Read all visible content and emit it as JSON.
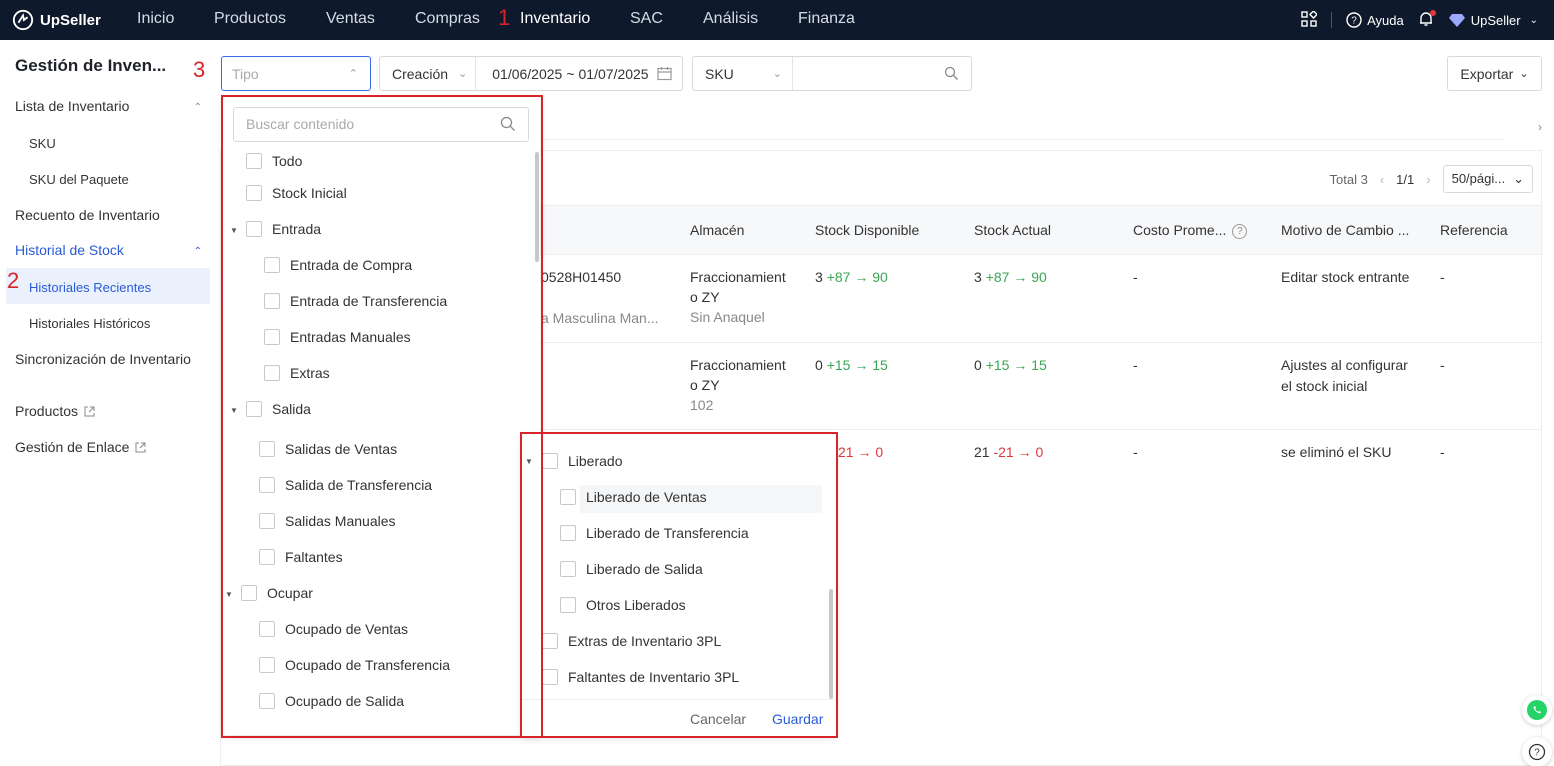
{
  "topbar": {
    "brand": "UpSeller",
    "nav": [
      "Inicio",
      "Productos",
      "Ventas",
      "Compras",
      "Inventario",
      "SAC",
      "Análisis",
      "Finanza"
    ],
    "active_nav": "Inventario",
    "help": "Ayuda",
    "user": "UpSeller"
  },
  "annotations": {
    "one": "1",
    "two": "2",
    "three": "3"
  },
  "sidebar": {
    "title": "Gestión de Inven...",
    "items": {
      "lista": "Lista de Inventario",
      "sku": "SKU",
      "sku_paquete": "SKU del Paquete",
      "recuento": "Recuento de Inventario",
      "historial": "Historial de Stock",
      "recientes": "Historiales Recientes",
      "historicos": "Historiales Históricos",
      "sincronizacion": "Sincronización de Inventario",
      "productos": "Productos",
      "enlace": "Gestión de Enlace"
    }
  },
  "filters": {
    "tipo_placeholder": "Tipo",
    "date_type": "Creación",
    "date_from": "01/06/2025",
    "date_sep": "~",
    "date_to": "01/07/2025",
    "search_field": "SKU",
    "export": "Exportar"
  },
  "pager": {
    "total": "Total 3",
    "page": "1/1",
    "page_size": "50/pági..."
  },
  "table": {
    "headers": [
      "Almacén",
      "Stock Disponible",
      "Stock Actual",
      "Costo Prome...",
      "Motivo de Cambio ...",
      "Referencia"
    ],
    "rows": [
      {
        "sku": "0528H01450",
        "product": "a Masculina Man...",
        "warehouse": "Fraccionamient",
        "warehouse2": "o ZY",
        "shelf": "Sin Anaquel",
        "disp_base": "3",
        "disp_delta": "+87 → 90",
        "act_base": "3",
        "act_delta": "+87 → 90",
        "cost": "-",
        "reason": "Editar stock entrante",
        "reason2": "",
        "ref": "-"
      },
      {
        "sku": "",
        "product": "",
        "warehouse": "Fraccionamient",
        "warehouse2": "o ZY",
        "shelf": "102",
        "disp_base": "0",
        "disp_delta": "+15 → 15",
        "act_base": "0",
        "act_delta": "+15 → 15",
        "cost": "-",
        "reason": "Ajustes al configurar",
        "reason2": "el stock inicial",
        "ref": "-"
      },
      {
        "disp_delta": "21 → 0",
        "act_base": "21",
        "act_delta": "-21 → 0",
        "cost": "-",
        "reason": "se eliminó el SKU",
        "ref": "-"
      }
    ]
  },
  "dropdown": {
    "search_placeholder": "Buscar contenido",
    "left": {
      "todo": "Todo",
      "stock_inicial": "Stock Inicial",
      "entrada": "Entrada",
      "entrada_compra": "Entrada de Compra",
      "entrada_transferencia": "Entrada de Transferencia",
      "entradas_manuales": "Entradas Manuales",
      "extras": "Extras",
      "salida": "Salida",
      "salidas_ventas": "Salidas de Ventas",
      "salida_transferencia": "Salida de Transferencia",
      "salidas_manuales": "Salidas Manuales",
      "faltantes": "Faltantes",
      "ocupar": "Ocupar",
      "ocupado_ventas": "Ocupado de Ventas",
      "ocupado_transferencia": "Ocupado de Transferencia",
      "ocupado_salida": "Ocupado de Salida"
    },
    "right": {
      "liberado": "Liberado",
      "liberado_ventas": "Liberado de Ventas",
      "liberado_transferencia": "Liberado de Transferencia",
      "liberado_salida": "Liberado de Salida",
      "otros_liberados": "Otros Liberados",
      "extras_3pl": "Extras de Inventario 3PL",
      "faltantes_3pl": "Faltantes de Inventario 3PL"
    },
    "cancel": "Cancelar",
    "save": "Guardar"
  },
  "colors": {
    "brand_dark": "#0e1a2b",
    "accent_blue": "#2a5bd7",
    "annotation_red": "#d8232a",
    "positive": "#3aa655",
    "negative": "#e0383e"
  }
}
